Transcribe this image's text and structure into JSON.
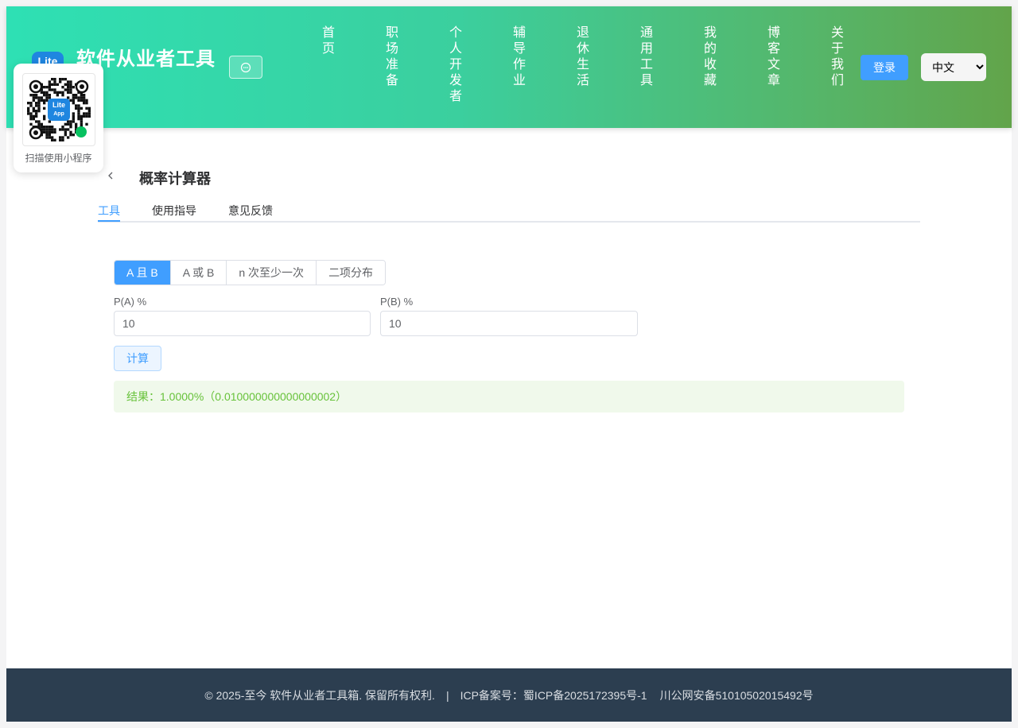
{
  "header": {
    "logo_text": "Lite",
    "title": "软件从业者工具",
    "nav": [
      "首页",
      "职场准备",
      "个人开发者",
      "辅导作业",
      "退休生活",
      "通用工具",
      "我的收藏",
      "博客文章",
      "关于我们"
    ],
    "login_label": "登录",
    "language": {
      "selected": "中文"
    }
  },
  "qr": {
    "label": "扫描使用小程序",
    "logo_top": "Lite",
    "logo_bottom": "App"
  },
  "main": {
    "title": "概率计算器",
    "tabs": [
      "工具",
      "使用指导",
      "意见反馈"
    ],
    "modes": [
      "A 且 B",
      "A 或 B",
      "n 次至少一次",
      "二项分布"
    ],
    "field_a": {
      "label": "P(A) %",
      "value": "10"
    },
    "field_b": {
      "label": "P(B) %",
      "value": "10"
    },
    "calc_label": "计算",
    "result": "结果：1.0000%（0.010000000000000002）"
  },
  "footer": {
    "copyright": "© 2025-至今 软件从业者工具箱. 保留所有权利.",
    "separator": "|",
    "icp": "ICP备案号：蜀ICP备2025172395号-1",
    "police": "川公网安备51010502015492号"
  },
  "colors": {
    "primary": "#409eff",
    "success": "#67c23a",
    "footer_bg": "#2c3e50"
  }
}
